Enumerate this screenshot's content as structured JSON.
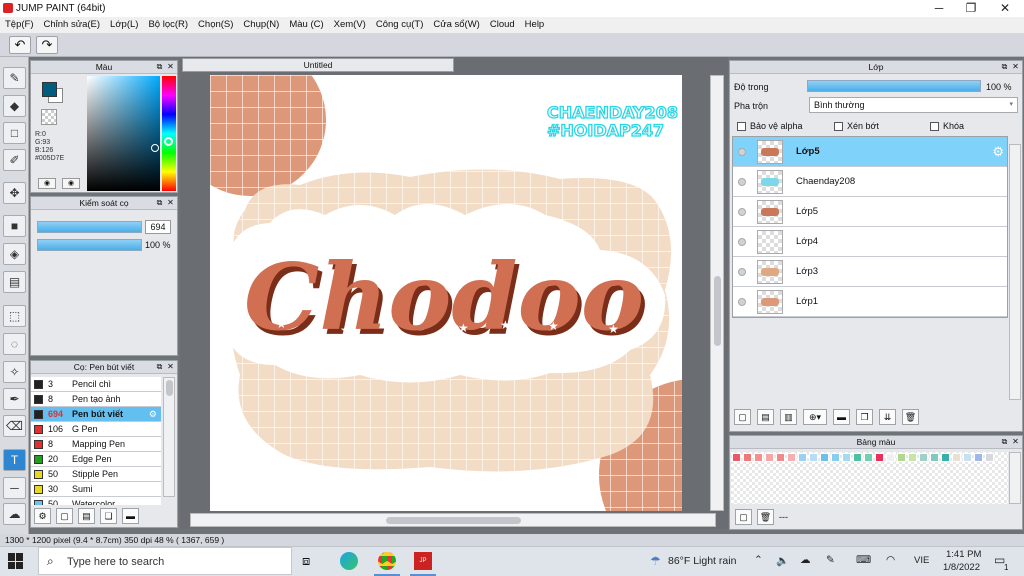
{
  "window": {
    "title": "JUMP PAINT (64bit)",
    "min": "─",
    "max": "❐",
    "close": "✕"
  },
  "menu": [
    "Tệp(F)",
    "Chỉnh sửa(E)",
    "Lớp(L)",
    "Bộ lọc(R)",
    "Chọn(S)",
    "Chụp(N)",
    "Màu (C)",
    "Xem(V)",
    "Công cụ(T)",
    "Cửa sổ(W)",
    "Cloud",
    "Help"
  ],
  "toolbar": {
    "undo": "↶",
    "redo": "↷"
  },
  "color_panel": {
    "title": "Màu",
    "r": "R:0",
    "g": "G:93",
    "b": "B:126",
    "hex": "#005D7E",
    "fg_color": "#005d7e"
  },
  "brush_control": {
    "title": "Kiểm soát cọ",
    "size": "694",
    "size_level": 1.0,
    "opacity": "100 %",
    "opacity_level": 1.0
  },
  "brush_panel": {
    "title": "Cọ: Pen bút viết",
    "items": [
      {
        "size": "3",
        "name": "Pencil chì",
        "color": "#222222"
      },
      {
        "size": "8",
        "name": "Pen tạo ảnh",
        "color": "#222222"
      },
      {
        "size": "694",
        "name": "Pen bút viết",
        "color": "#222222",
        "selected": true
      },
      {
        "size": "106",
        "name": "G Pen",
        "color": "#e03030"
      },
      {
        "size": "8",
        "name": "Mapping Pen",
        "color": "#e03030"
      },
      {
        "size": "20",
        "name": "Edge Pen",
        "color": "#20a020"
      },
      {
        "size": "50",
        "name": "Stipple Pen",
        "color": "#e8d820"
      },
      {
        "size": "30",
        "name": "Sumi",
        "color": "#e8d820"
      },
      {
        "size": "50",
        "name": "Watercolor",
        "color": "#6ac0f0"
      }
    ]
  },
  "document": {
    "tab": "Untitled"
  },
  "artwork": {
    "main_text": "Chodoo",
    "watermark_line1": "CHAENDAY208",
    "watermark_line2": "#HOIDAP247"
  },
  "layer_panel": {
    "title": "Lớp",
    "opacity_label": "Độ trong",
    "opacity_value": "100 %",
    "opacity_level": 1.0,
    "blend_label": "Pha trộn",
    "blend_value": "Bình thường",
    "protect_alpha": "Bảo vệ alpha",
    "clipping": "Xén bớt",
    "lock": "Khóa",
    "layers": [
      {
        "name": "Lớp5",
        "selected": true
      },
      {
        "name": "Chaenday208"
      },
      {
        "name": "Lớp5"
      },
      {
        "name": "Lớp4"
      },
      {
        "name": "Lớp3"
      },
      {
        "name": "Lớp1"
      }
    ]
  },
  "palette_panel": {
    "title": "Bảng màu",
    "footer": "---",
    "swatches": [
      "#e85a6a",
      "#f07878",
      "#f49090",
      "#f6a6a6",
      "#f08a8a",
      "#f4b0b0",
      "#9ad0f0",
      "#b8dcf4",
      "#6cc0e8",
      "#88ccee",
      "#a6daf0",
      "#50c0a0",
      "#70d0b0",
      "#e8305a",
      "#f0f0f0",
      "#b0d890",
      "#c8e4a8",
      "#a0d0c8",
      "#80c8c0",
      "#38b0a8",
      "#e8e0d0",
      "#c8e0f0",
      "#a0b8e8",
      "#d8d8e0"
    ]
  },
  "status": {
    "text": "1300 * 1200 pixel  (9.4 * 8.7cm)  350 dpi  48 %  ( 1367, 659 )"
  },
  "taskbar": {
    "search_placeholder": "Type here to search",
    "weather": "86°F  Light rain",
    "lang": "VIE",
    "time": "1:41 PM",
    "date": "1/8/2022",
    "notify_count": "1"
  }
}
